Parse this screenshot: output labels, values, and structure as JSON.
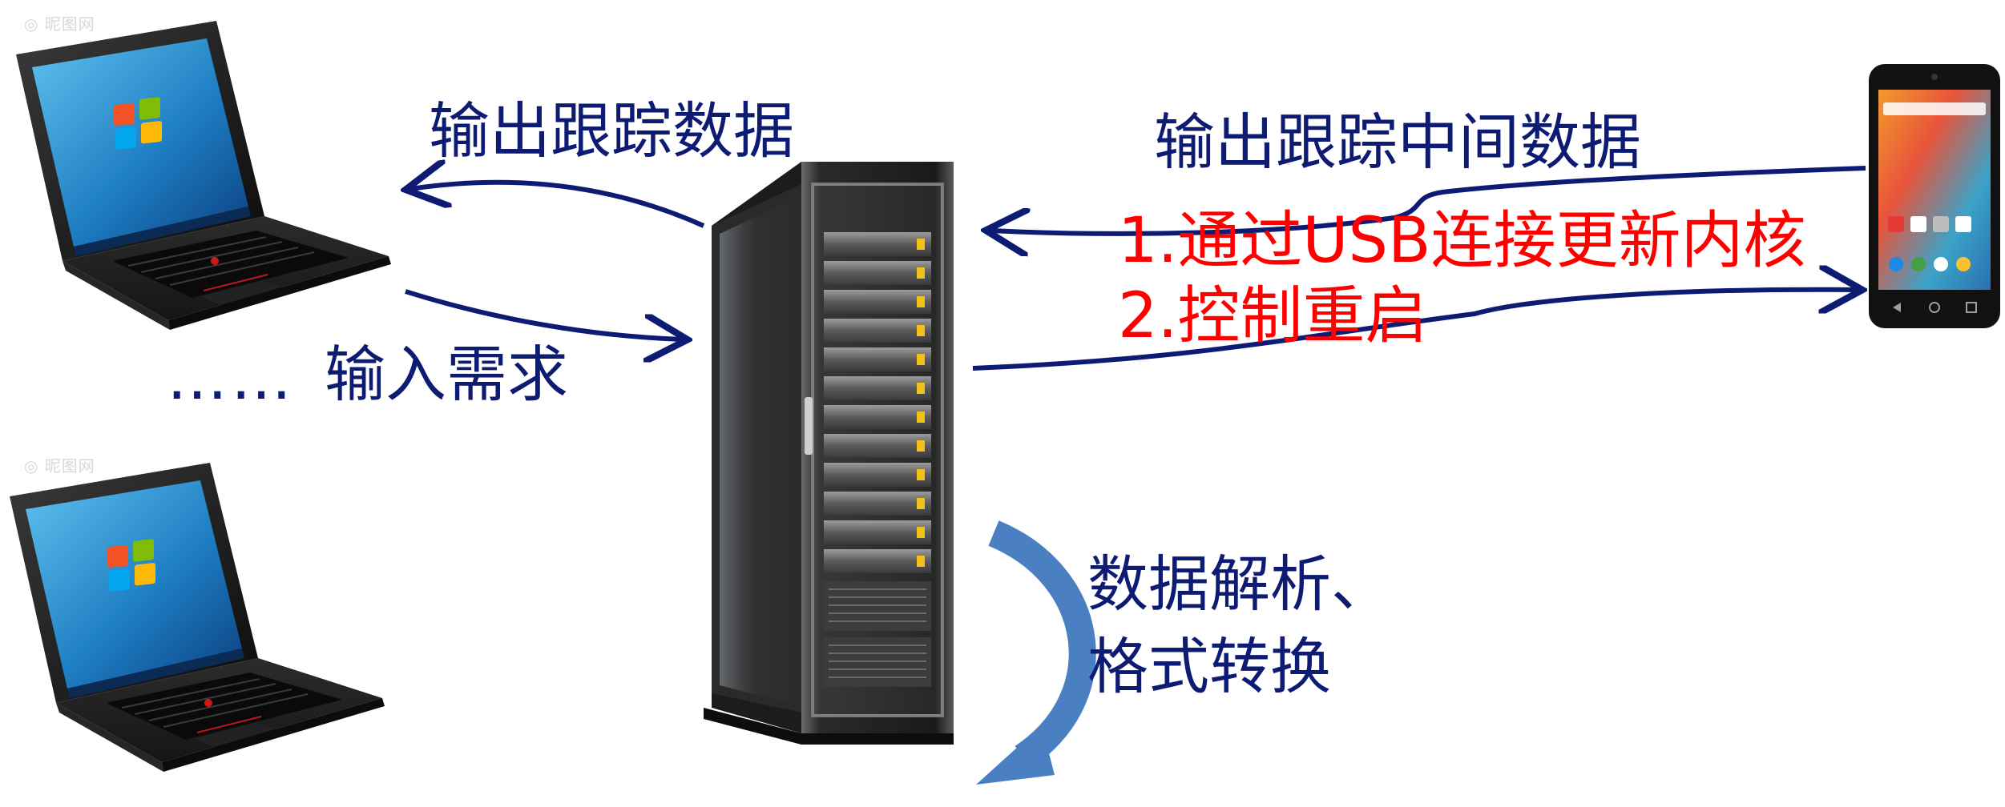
{
  "labels": {
    "output_tracking_data": "输出跟踪数据",
    "ellipsis": "……",
    "input_request": "输入需求",
    "output_intermediate_data": "输出跟踪中间数据",
    "step_1": "1.通过USB连接更新内核",
    "step_2": "2.控制重启",
    "parse_line_1": "数据解析、",
    "parse_line_2": "格式转换"
  },
  "devices": {
    "laptop_icon": "laptop-icon",
    "server_icon": "server-rack-icon",
    "phone_icon": "smartphone-icon"
  },
  "colors": {
    "arrow_navy": "#0d1b73",
    "label_navy": "#0d1b73",
    "label_red": "#ff0000",
    "cycle_arrow": "#4a7fc1"
  }
}
